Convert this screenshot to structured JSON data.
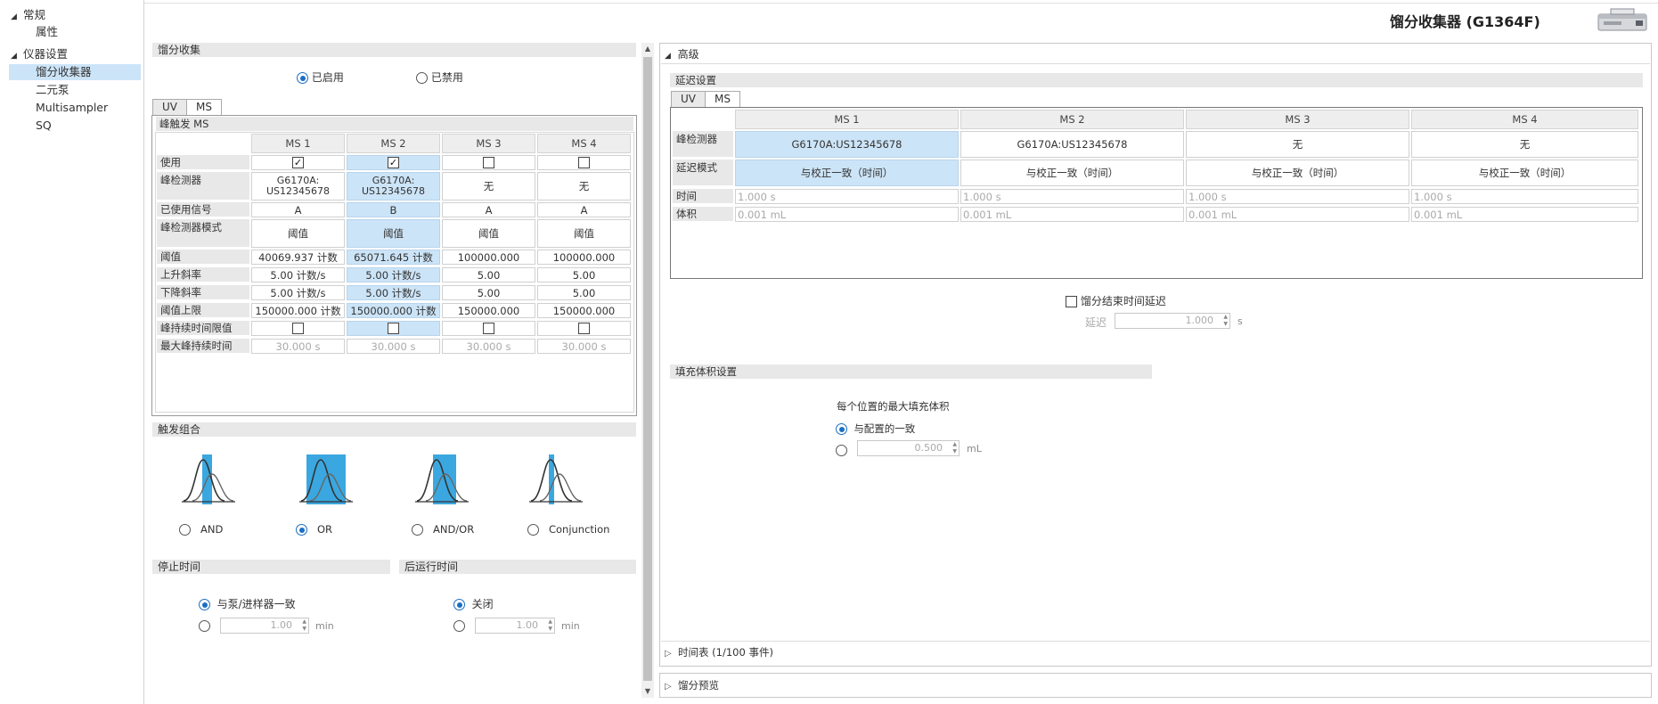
{
  "nav": {
    "groups": [
      {
        "label": "常规",
        "items": [
          {
            "label": "属性"
          }
        ]
      },
      {
        "label": "仪器设置",
        "items": [
          {
            "label": "馏分收集器"
          },
          {
            "label": "二元泵"
          },
          {
            "label": "Multisampler"
          },
          {
            "label": "SQ"
          }
        ]
      }
    ]
  },
  "header": {
    "title": "馏分收集器 (G1364F)"
  },
  "fraction": {
    "section": "馏分收集",
    "enabled": "已启用",
    "disabled": "已禁用",
    "tabs": [
      "UV",
      "MS"
    ],
    "trigger_title": "峰触发 MS",
    "columns": [
      "MS 1",
      "MS 2",
      "MS 3",
      "MS 4"
    ],
    "rows": {
      "use": "使用",
      "detector": "峰检测器",
      "signal": "已使用信号",
      "mode": "峰检测器模式",
      "threshold": "阈值",
      "up": "上升斜率",
      "down": "下降斜率",
      "upper": "阈值上限",
      "duration_limit": "峰持续时间限值",
      "max_duration": "最大峰持续时间"
    },
    "detector": [
      "G6170A:\nUS12345678",
      "G6170A:\nUS12345678",
      "无",
      "无"
    ],
    "signal": [
      "A",
      "B",
      "A",
      "A"
    ],
    "mode": [
      "阈值",
      "阈值",
      "阈值",
      "阈值"
    ],
    "threshold": [
      "40069.937 计数",
      "65071.645 计数",
      "100000.000",
      "100000.000"
    ],
    "up": [
      "5.00 计数/s",
      "5.00 计数/s",
      "5.00",
      "5.00"
    ],
    "down": [
      "5.00 计数/s",
      "5.00 计数/s",
      "5.00",
      "5.00"
    ],
    "upper": [
      "150000.000 计数",
      "150000.000 计数",
      "150000.000",
      "150000.000"
    ],
    "max_duration": [
      "30.000 s",
      "30.000 s",
      "30.000 s",
      "30.000 s"
    ]
  },
  "trigger_combo": {
    "section": "触发组合",
    "options": [
      "AND",
      "OR",
      "AND/OR",
      "Conjunction"
    ]
  },
  "stop_time": {
    "section": "停止时间",
    "opt1": "与泵/进样器一致",
    "value": "1.00",
    "unit": "min"
  },
  "post_time": {
    "section": "后运行时间",
    "opt1": "关闭",
    "value": "1.00",
    "unit": "min"
  },
  "advanced": {
    "title": "高级",
    "delay_section": "延迟设置",
    "tabs": [
      "UV",
      "MS"
    ],
    "columns": [
      "MS 1",
      "MS 2",
      "MS 3",
      "MS 4"
    ],
    "row_detector": "峰检测器",
    "row_mode": "延迟模式",
    "row_time": "时间",
    "row_volume": "体积",
    "detector": [
      "G6170A:US12345678",
      "G6170A:US12345678",
      "无",
      "无"
    ],
    "mode": [
      "与校正一致（时间）",
      "与校正一致（时间）",
      "与校正一致（时间）",
      "与校正一致（时间）"
    ],
    "time": [
      "1.000 s",
      "1.000 s",
      "1.000 s",
      "1.000 s"
    ],
    "volume": [
      "0.001 mL",
      "0.001 mL",
      "0.001 mL",
      "0.001 mL"
    ],
    "end_delay": "馏分结束时间延迟",
    "delay_label": "延迟",
    "delay_value": "1.000",
    "delay_unit": "s",
    "fill_section": "填充体积设置",
    "fill_title": "每个位置的最大填充体积",
    "fill_opt1": "与配置的一致",
    "fill_value": "0.500",
    "fill_unit": "mL",
    "timetable": "时间表 (1/100 事件)",
    "preview": "馏分预览"
  },
  "colors": {
    "accent": "#1a6fc4",
    "selection": "#cce4f7",
    "peak_fill": "#3ba7e0"
  }
}
